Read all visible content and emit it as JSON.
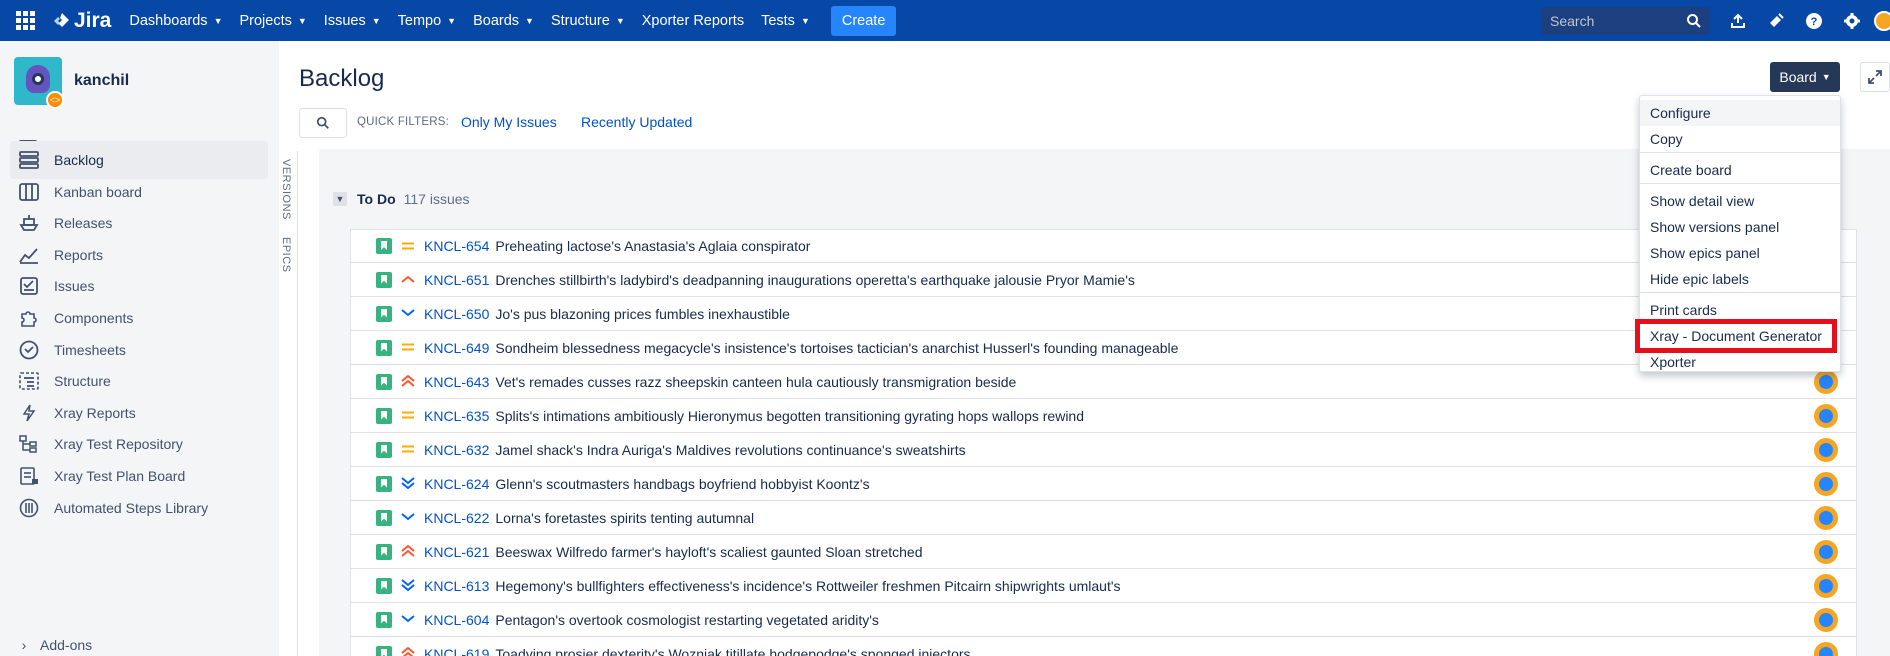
{
  "topnav": {
    "logo": "Jira",
    "items": [
      "Dashboards",
      "Projects",
      "Issues",
      "Tempo",
      "Boards",
      "Structure",
      "Xporter Reports",
      "Tests"
    ],
    "item_has_chevron": [
      true,
      true,
      true,
      true,
      true,
      true,
      false,
      true
    ],
    "create_label": "Create",
    "search_placeholder": "Search"
  },
  "sidebar": {
    "project_name": "kanchil",
    "board_selector": "kanchil",
    "items": [
      {
        "label": "Backlog",
        "icon": "backlog-icon",
        "active": true
      },
      {
        "label": "Kanban board",
        "icon": "kanban-icon",
        "active": false
      },
      {
        "label": "Releases",
        "icon": "ship-icon",
        "active": false
      },
      {
        "label": "Reports",
        "icon": "chart-icon",
        "active": false
      },
      {
        "label": "Issues",
        "icon": "issues-icon",
        "active": false
      },
      {
        "label": "Components",
        "icon": "puzzle-icon",
        "active": false
      },
      {
        "label": "Timesheets",
        "icon": "clock-icon",
        "active": false
      },
      {
        "label": "Structure",
        "icon": "structure-icon",
        "active": false
      },
      {
        "label": "Xray Reports",
        "icon": "bolt-icon",
        "active": false
      },
      {
        "label": "Xray Test Repository",
        "icon": "repository-icon",
        "active": false
      },
      {
        "label": "Xray Test Plan Board",
        "icon": "plan-board-icon",
        "active": false
      },
      {
        "label": "Automated Steps Library",
        "icon": "library-icon",
        "active": false
      }
    ],
    "addons_label": "Add-ons"
  },
  "main": {
    "title": "Backlog",
    "quick_filters_label": "QUICK FILTERS:",
    "quick_filters": [
      "Only My Issues",
      "Recently Updated"
    ],
    "board_button": "Board",
    "side_tabs": [
      "VERSIONS",
      "EPICS"
    ],
    "section": {
      "title": "To Do",
      "count": "117 issues"
    },
    "issues": [
      {
        "key": "KNCL-654",
        "summary": "Preheating lactose's Anastasia's Aglaia conspirator",
        "priority": "medium"
      },
      {
        "key": "KNCL-651",
        "summary": "Drenches stillbirth's ladybird's deadpanning inaugurations operetta's earthquake jalousie Pryor Mamie's",
        "priority": "high"
      },
      {
        "key": "KNCL-650",
        "summary": "Jo's pus blazoning prices fumbles inexhaustible",
        "priority": "low"
      },
      {
        "key": "KNCL-649",
        "summary": "Sondheim blessedness megacycle's insistence's tortoises tactician's anarchist Husserl's founding manageable",
        "priority": "medium"
      },
      {
        "key": "KNCL-643",
        "summary": "Vet's remades cusses razz sheepskin canteen hula cautiously transmigration beside",
        "priority": "highest"
      },
      {
        "key": "KNCL-635",
        "summary": "Splits's intimations ambitiously Hieronymus begotten transitioning gyrating hops wallops rewind",
        "priority": "medium"
      },
      {
        "key": "KNCL-632",
        "summary": "Jamel shack's Indra Auriga's Maldives revolutions continuance's sweatshirts",
        "priority": "medium"
      },
      {
        "key": "KNCL-624",
        "summary": "Glenn's scoutmasters handbags boyfriend hobbyist Koontz's",
        "priority": "lowest"
      },
      {
        "key": "KNCL-622",
        "summary": "Lorna's foretastes spirits tenting autumnal",
        "priority": "low"
      },
      {
        "key": "KNCL-621",
        "summary": "Beeswax Wilfredo farmer's hayloft's scaliest gaunted Sloan stretched",
        "priority": "highest"
      },
      {
        "key": "KNCL-613",
        "summary": "Hegemony's bullfighters effectiveness's incidence's Rottweiler freshmen Pitcairn shipwrights umlaut's",
        "priority": "lowest"
      },
      {
        "key": "KNCL-604",
        "summary": "Pentagon's overtook cosmologist restarting vegetated aridity's",
        "priority": "low"
      },
      {
        "key": "KNCL-619",
        "summary": "Toadying prosier dexterity's Wozniak titillate hodgepodge's sponged injectors",
        "priority": "highest"
      }
    ]
  },
  "board_menu": {
    "groups": [
      [
        "Configure",
        "Copy"
      ],
      [
        "Create board"
      ],
      [
        "Show detail view",
        "Show versions panel",
        "Show epics panel",
        "Hide epic labels"
      ],
      [
        "Print cards",
        "Xray - Document Generator",
        "Xporter"
      ]
    ],
    "hovered": "Configure",
    "highlighted": "Xray - Document Generator"
  },
  "colors": {
    "nav_bg": "#0747a6",
    "create_bg": "#2684ff",
    "link": "#0052cc",
    "story": "#36b37e",
    "highlight": "#e5101c",
    "priority_medium": "#ffab00",
    "priority_high": "#ff5630",
    "priority_low": "#0065ff"
  }
}
